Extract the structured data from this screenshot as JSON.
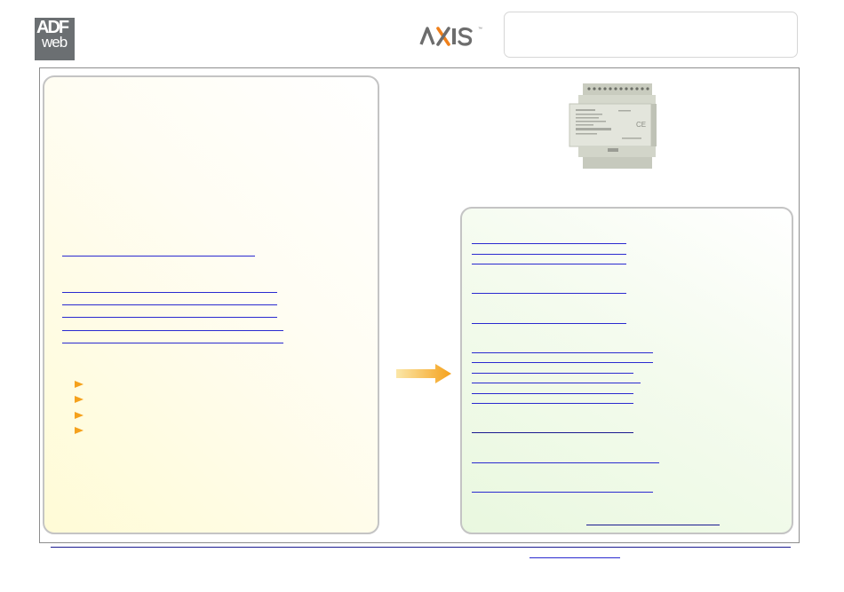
{
  "header": {
    "brand_logo": {
      "line1": "ADF",
      "line2": "web"
    },
    "product_logo": {
      "text": "AXIS",
      "tm": "™"
    }
  },
  "icons": {
    "bullet": "triangle-right-icon",
    "flow_arrow": "arrow-right-icon",
    "device": "din-rail-gateway-image"
  },
  "colors": {
    "link": "#2a2ad0",
    "link_dark": "#1a1a90",
    "bullet": "#f5a11c",
    "left_panel_tint": "#fffbd6",
    "right_panel_tint": "#e9f8df"
  }
}
